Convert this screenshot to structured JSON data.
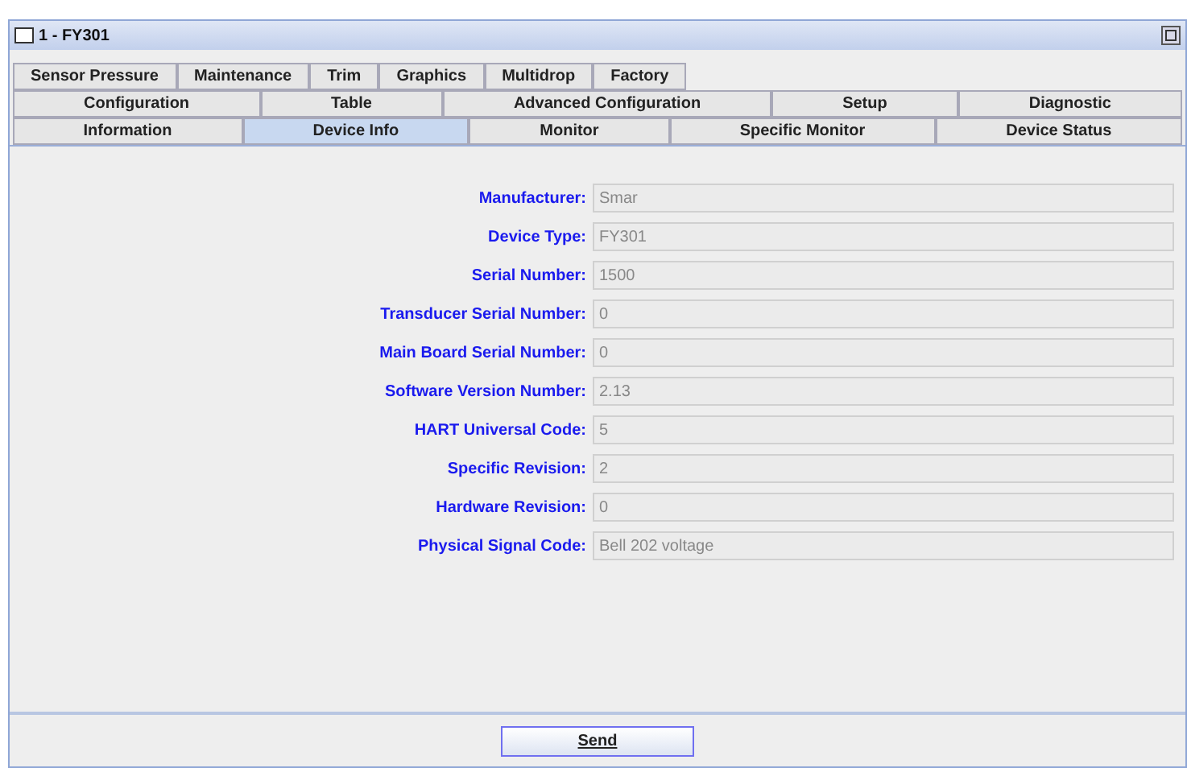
{
  "window": {
    "title": "1 - FY301"
  },
  "tab_rows": [
    [
      {
        "label": "Sensor Pressure",
        "selected": false
      },
      {
        "label": "Maintenance",
        "selected": false
      },
      {
        "label": "Trim",
        "selected": false
      },
      {
        "label": "Graphics",
        "selected": false
      },
      {
        "label": "Multidrop",
        "selected": false
      },
      {
        "label": "Factory",
        "selected": false
      }
    ],
    [
      {
        "label": "Configuration",
        "selected": false
      },
      {
        "label": "Table",
        "selected": false
      },
      {
        "label": "Advanced Configuration",
        "selected": false
      },
      {
        "label": "Setup",
        "selected": false
      },
      {
        "label": "Diagnostic",
        "selected": false
      }
    ],
    [
      {
        "label": "Information",
        "selected": false
      },
      {
        "label": "Device Info",
        "selected": true
      },
      {
        "label": "Monitor",
        "selected": false
      },
      {
        "label": "Specific Monitor",
        "selected": false
      },
      {
        "label": "Device Status",
        "selected": false
      }
    ]
  ],
  "fields": [
    {
      "label": "Manufacturer:",
      "value": "Smar"
    },
    {
      "label": "Device Type:",
      "value": "FY301"
    },
    {
      "label": "Serial Number:",
      "value": "1500"
    },
    {
      "label": "Transducer Serial Number:",
      "value": "0"
    },
    {
      "label": "Main Board Serial Number:",
      "value": "0"
    },
    {
      "label": "Software Version Number:",
      "value": "2.13"
    },
    {
      "label": "HART Universal Code:",
      "value": "5"
    },
    {
      "label": "Specific Revision:",
      "value": "2"
    },
    {
      "label": "Hardware Revision:",
      "value": "0"
    },
    {
      "label": "Physical Signal Code:",
      "value": "Bell 202 voltage"
    }
  ],
  "buttons": [
    "Send"
  ]
}
